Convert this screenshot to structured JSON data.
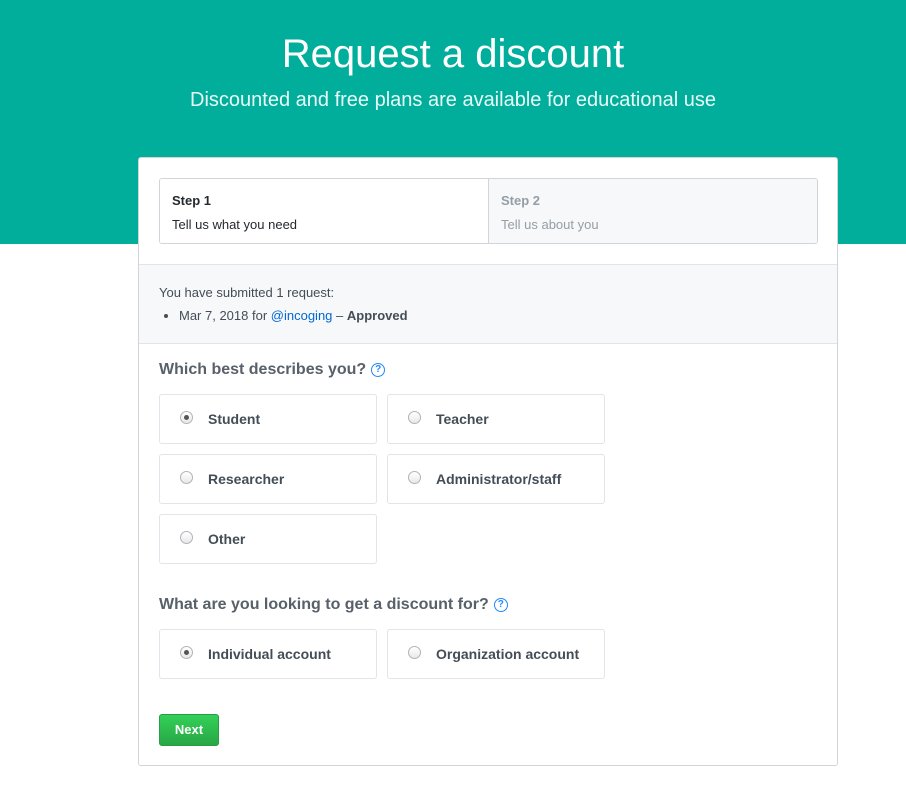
{
  "header": {
    "title": "Request a discount",
    "subtitle": "Discounted and free plans are available for educational use"
  },
  "steps": [
    {
      "title": "Step 1",
      "description": "Tell us what you need",
      "active": true
    },
    {
      "title": "Step 2",
      "description": "Tell us about you",
      "active": false
    }
  ],
  "notice": {
    "text": "You have submitted 1 request:",
    "request": {
      "date_prefix": "Mar 7, 2018 for ",
      "account": "@incoging",
      "separator": " – ",
      "status": "Approved"
    }
  },
  "question1": {
    "label": "Which best describes you?",
    "options": [
      {
        "label": "Student",
        "checked": true
      },
      {
        "label": "Teacher",
        "checked": false
      },
      {
        "label": "Researcher",
        "checked": false
      },
      {
        "label": "Administrator/staff",
        "checked": false
      },
      {
        "label": "Other",
        "checked": false
      }
    ]
  },
  "question2": {
    "label": "What are you looking to get a discount for?",
    "options": [
      {
        "label": "Individual account",
        "checked": true
      },
      {
        "label": "Organization account",
        "checked": false
      }
    ]
  },
  "actions": {
    "next_label": "Next"
  },
  "colors": {
    "hero_background": "#00ae9b",
    "link": "#0366d6",
    "button": "#28a745"
  }
}
